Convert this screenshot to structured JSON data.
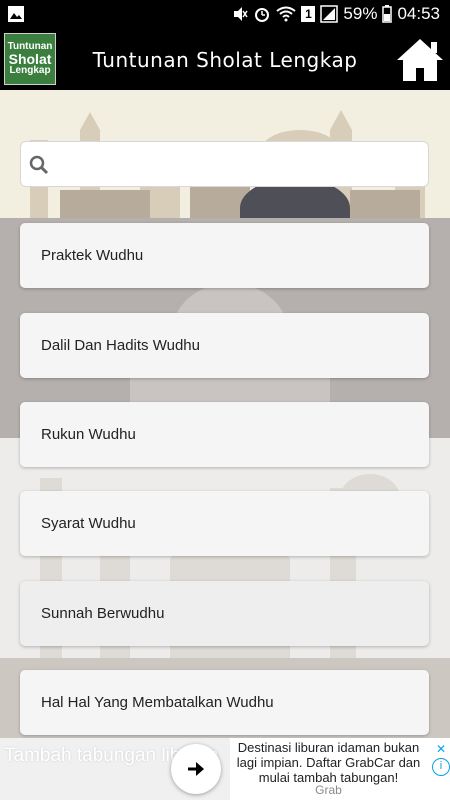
{
  "status_bar": {
    "battery_percent": "59%",
    "time": "04:53",
    "sim_badge": "1"
  },
  "app_bar": {
    "icon_lines": [
      "Tuntunan",
      "Sholat",
      "Lengkap"
    ],
    "title": "Tuntunan Sholat Lengkap"
  },
  "search": {
    "placeholder": "",
    "value": ""
  },
  "list": {
    "items": [
      {
        "label": "Praktek Wudhu"
      },
      {
        "label": "Dalil Dan Hadits Wudhu"
      },
      {
        "label": "Rukun Wudhu"
      },
      {
        "label": "Syarat Wudhu"
      },
      {
        "label": "Sunnah Berwudhu"
      },
      {
        "label": "Hal Hal Yang Membatalkan Wudhu"
      }
    ]
  },
  "ad": {
    "headline": "Tambah tabungan liburan",
    "body": "Destinasi liburan idaman bukan lagi impian. Daftar GrabCar dan mulai tambah tabungan!",
    "brand": "Grab",
    "close_icon": "close-icon",
    "info_icon": "info-icon"
  },
  "colors": {
    "app_bar": "#000000",
    "hero_bg": "#f2efe0",
    "list_bg": "#a39d9a",
    "card_bg": "#f5f5f5"
  }
}
